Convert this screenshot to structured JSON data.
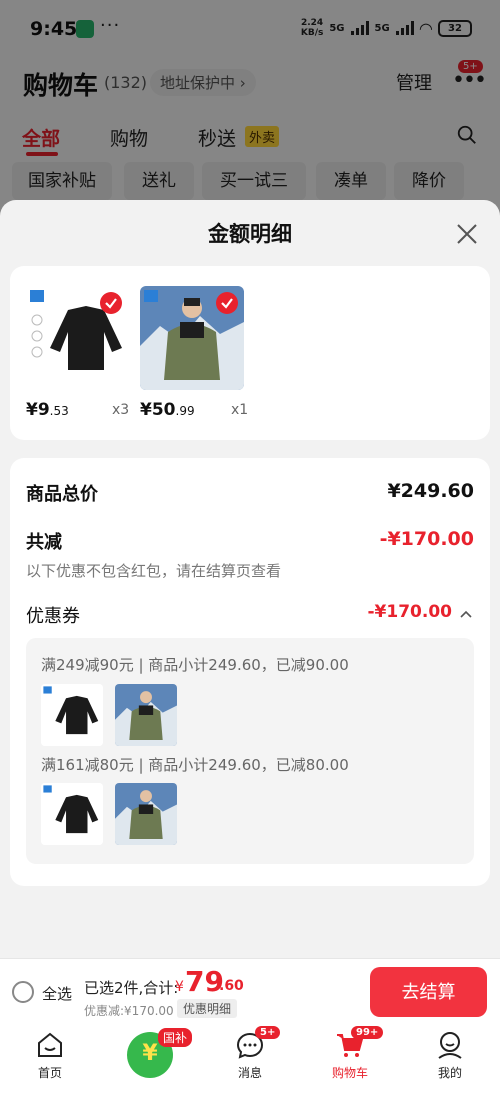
{
  "status_bar": {
    "time": "9:45",
    "dots": "···",
    "speed_top": "2.24",
    "speed_bottom": "KB/s",
    "network": "5G",
    "battery": "32"
  },
  "header": {
    "title": "购物车",
    "count": "(132)",
    "address_protect": "地址保护中 ›",
    "manage_label": "管理",
    "more_badge": "5+"
  },
  "tabs": [
    {
      "label": "全部"
    },
    {
      "label": "购物"
    },
    {
      "label": "秒送"
    }
  ],
  "takeout_tag": "外卖",
  "chips": [
    "国家补贴",
    "送礼",
    "买一试三",
    "凑单",
    "降价"
  ],
  "sheet": {
    "title": "金额明细",
    "items": [
      {
        "price_int": "¥9",
        "price_dec": ".53",
        "qty": "x3"
      },
      {
        "price_int": "¥50",
        "price_dec": ".99",
        "qty": "x1"
      }
    ],
    "total_label": "商品总价",
    "total_value": "¥249.60",
    "reduce_label": "共减",
    "reduce_value": "-¥170.00",
    "reduce_hint": "以下优惠不包含红包，请在结算页查看",
    "coupon_label": "优惠券",
    "coupon_value": "-¥170.00",
    "coupon_rules": [
      "满249减90元 | 商品小计249.60，已减90.00",
      "满161减80元 | 商品小计249.60，已减80.00"
    ]
  },
  "checkout": {
    "select_all": "全选",
    "selected_text": "已选2件,合计:",
    "total_symbol": "¥",
    "total_int": "79",
    "total_dec": ".60",
    "discount_text": "优惠减:¥170.00",
    "detail_tag": "优惠明细",
    "button_label": "去结算"
  },
  "nav": {
    "items": [
      {
        "label": "首页"
      },
      {
        "label": "消息",
        "badge": "5+"
      },
      {
        "label": "购物车",
        "badge": "99+"
      },
      {
        "label": "我的"
      }
    ],
    "gov_badge": "国补",
    "gov_symbol": "¥"
  },
  "colors": {
    "accent": "#e8222d",
    "checkout_button": "#f2333f",
    "gov_green": "#36b84c"
  }
}
